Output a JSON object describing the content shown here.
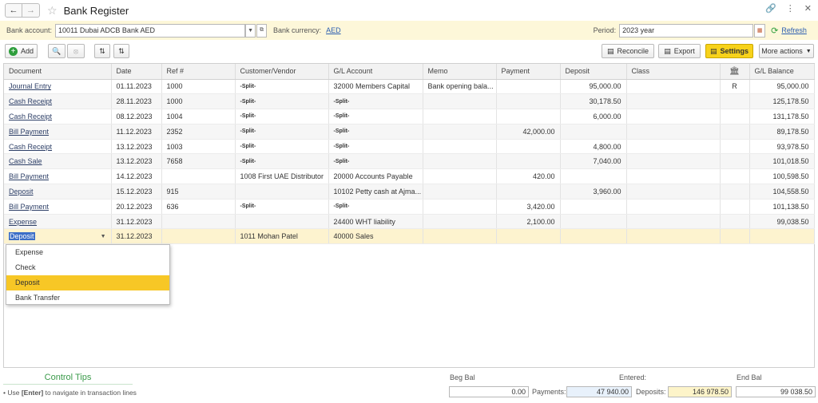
{
  "window": {
    "title": "Bank Register"
  },
  "params": {
    "bank_account_label": "Bank account:",
    "bank_account_value": "10011 Dubai ADCB Bank AED",
    "currency_label": "Bank currency:",
    "currency_value": "AED",
    "period_label": "Period:",
    "period_value": "2023 year",
    "refresh_label": "Refresh"
  },
  "toolbar": {
    "add_label": "Add",
    "reconcile_label": "Reconcile",
    "export_label": "Export",
    "settings_label": "Settings",
    "more_actions_label": "More actions"
  },
  "table": {
    "headers": {
      "document": "Document",
      "date": "Date",
      "ref": "Ref #",
      "customer": "Customer/Vendor",
      "gl_account": "G/L Account",
      "memo": "Memo",
      "payment": "Payment",
      "deposit": "Deposit",
      "class": "Class",
      "gl_balance": "G/L Balance"
    },
    "rows": [
      {
        "document": "Journal Entry",
        "date": "01.11.2023",
        "ref": "1000",
        "customer": "-Split-",
        "gl_account": "32000 Members Capital",
        "memo": "Bank opening bala...",
        "payment": "",
        "deposit": "95,000.00",
        "class": "",
        "reconciled": "R",
        "gl_balance": "95,000.00"
      },
      {
        "document": "Cash Receipt",
        "date": "28.11.2023",
        "ref": "1000",
        "customer": "-Split-",
        "gl_account": "-Split-",
        "memo": "",
        "payment": "",
        "deposit": "30,178.50",
        "class": "",
        "reconciled": "",
        "gl_balance": "125,178.50"
      },
      {
        "document": "Cash Receipt",
        "date": "08.12.2023",
        "ref": "1004",
        "customer": "-Split-",
        "gl_account": "-Split-",
        "memo": "",
        "payment": "",
        "deposit": "6,000.00",
        "class": "",
        "reconciled": "",
        "gl_balance": "131,178.50"
      },
      {
        "document": "Bill Payment",
        "date": "11.12.2023",
        "ref": "2352",
        "customer": "-Split-",
        "gl_account": "-Split-",
        "memo": "",
        "payment": "42,000.00",
        "deposit": "",
        "class": "",
        "reconciled": "",
        "gl_balance": "89,178.50"
      },
      {
        "document": "Cash Receipt",
        "date": "13.12.2023",
        "ref": "1003",
        "customer": "-Split-",
        "gl_account": "-Split-",
        "memo": "",
        "payment": "",
        "deposit": "4,800.00",
        "class": "",
        "reconciled": "",
        "gl_balance": "93,978.50"
      },
      {
        "document": "Cash Sale",
        "date": "13.12.2023",
        "ref": "7658",
        "customer": "-Split-",
        "gl_account": "-Split-",
        "memo": "",
        "payment": "",
        "deposit": "7,040.00",
        "class": "",
        "reconciled": "",
        "gl_balance": "101,018.50"
      },
      {
        "document": "Bill Payment",
        "date": "14.12.2023",
        "ref": "",
        "customer": "1008 First UAE Distributor",
        "gl_account": "20000 Accounts Payable",
        "memo": "",
        "payment": "420.00",
        "deposit": "",
        "class": "",
        "reconciled": "",
        "gl_balance": "100,598.50"
      },
      {
        "document": "Deposit",
        "date": "15.12.2023",
        "ref": "915",
        "customer": "",
        "gl_account": "10102 Petty cash at Ajma...",
        "memo": "",
        "payment": "",
        "deposit": "3,960.00",
        "class": "",
        "reconciled": "",
        "gl_balance": "104,558.50"
      },
      {
        "document": "Bill Payment",
        "date": "20.12.2023",
        "ref": "636",
        "customer": "-Split-",
        "gl_account": "-Split-",
        "memo": "",
        "payment": "3,420.00",
        "deposit": "",
        "class": "",
        "reconciled": "",
        "gl_balance": "101,138.50"
      },
      {
        "document": "Expense",
        "date": "31.12.2023",
        "ref": "",
        "customer": "",
        "gl_account": "24400 WHT liability",
        "memo": "",
        "payment": "2,100.00",
        "deposit": "",
        "class": "",
        "reconciled": "",
        "gl_balance": "99,038.50"
      }
    ],
    "edit_row": {
      "document": "Deposit",
      "date": "31.12.2023",
      "customer": "1011 Mohan Patel",
      "gl_account": "40000 Sales"
    }
  },
  "dropdown": {
    "options": [
      "Expense",
      "Check",
      "Deposit",
      "Bank Transfer"
    ],
    "selected": "Deposit"
  },
  "footer": {
    "tips_title": "Control Tips",
    "tip_prefix": "• Use ",
    "tip_key": "[Enter]",
    "tip_suffix": " to navigate in transaction lines",
    "beg_bal_label": "Beg Bal",
    "beg_bal_value": "0.00",
    "entered_label": "Entered:",
    "payments_label": "Payments:",
    "payments_value": "47 940.00",
    "deposits_label": "Deposits:",
    "deposits_value": "146 978.50",
    "end_bal_label": "End Bal",
    "end_bal_value": "99 038.50"
  },
  "icons": {
    "back": "arrow-left-icon",
    "forward": "arrow-right-icon",
    "favorite": "star-icon",
    "link": "link-icon",
    "more": "more-vertical-icon",
    "close": "close-icon",
    "bank": "bank-icon"
  },
  "colors": {
    "accent_yellow": "#f7d21a",
    "params_bg": "#fdf7d9",
    "link_blue": "#2a5db0",
    "tips_green": "#3a9a4a",
    "add_green": "#2e9e3c"
  }
}
